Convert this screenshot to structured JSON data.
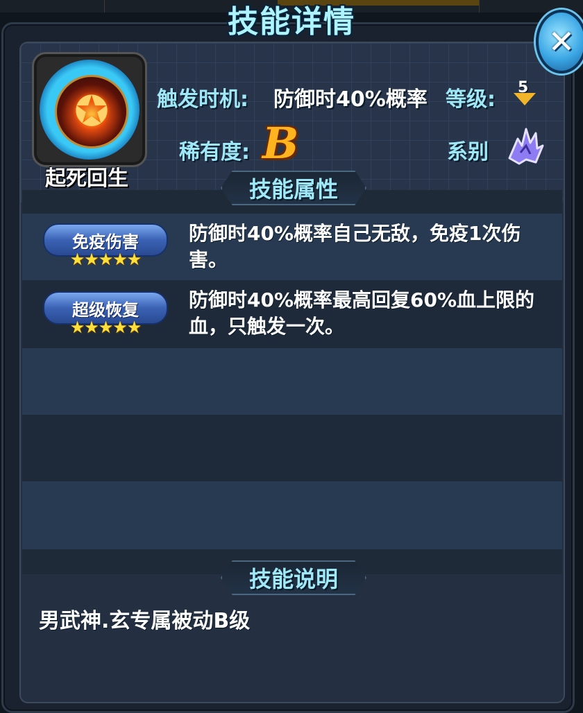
{
  "dialog": {
    "title": "技能详情",
    "close_label": "✕"
  },
  "skill": {
    "name": "起死回生",
    "trigger_label": "触发时机:",
    "trigger_value": "防御时40%概率",
    "level_label": "等级:",
    "level_value": "5",
    "rarity_label": "稀有度:",
    "rarity_value": "B",
    "type_label": "系别",
    "icon": "flaming-pentagram-icon",
    "type_icon": "beast-claw-icon"
  },
  "attributes": {
    "header": "技能属性",
    "items": [
      {
        "name": "免疫伤害",
        "stars": "★★★★★",
        "rating": 5,
        "description": "防御时40%概率自己无敌，免疫1次伤害。"
      },
      {
        "name": "超级恢复",
        "stars": "★★★★★",
        "rating": 5,
        "description": "防御时40%概率最高回复60%血上限的血，只触发一次。"
      }
    ]
  },
  "explanation": {
    "header": "技能说明",
    "text": "男武神.玄专属被动B级"
  },
  "colors": {
    "accent_cyan": "#9fe8f8",
    "rarity_gold": "#ffb31e",
    "badge_blue": "#3a62b4",
    "star_yellow": "#ffe03a"
  }
}
